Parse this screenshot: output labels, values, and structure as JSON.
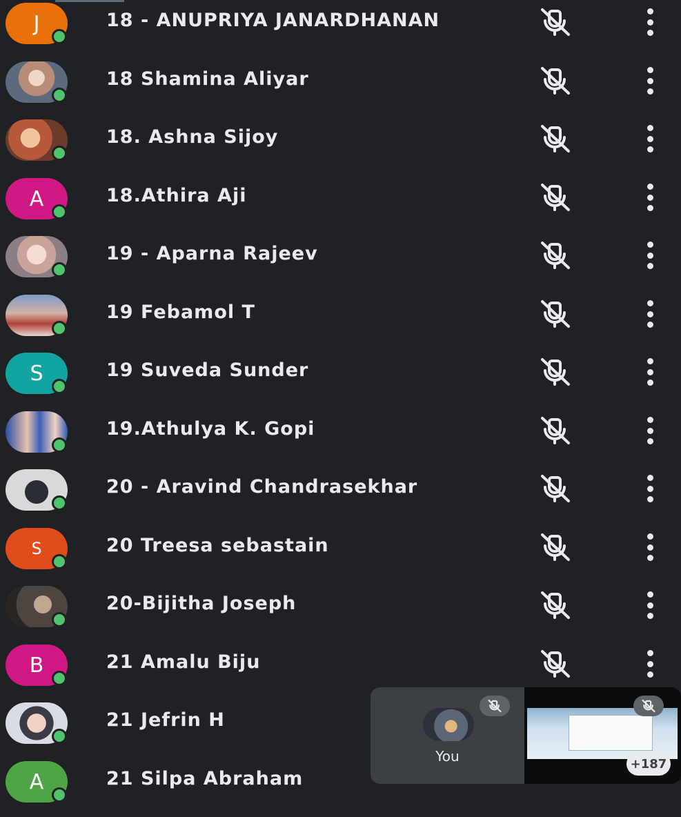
{
  "participants": [
    {
      "name": "18 - ANUPRIYA JANARDHANAN",
      "initial": "J",
      "color": "#e8710a"
    },
    {
      "name": "18 Shamina Aliyar",
      "initial": "",
      "color": ""
    },
    {
      "name": "18. Ashna Sijoy",
      "initial": "",
      "color": ""
    },
    {
      "name": "18.Athira Aji",
      "initial": "A",
      "color": "#d01884"
    },
    {
      "name": "19 - Aparna Rajeev",
      "initial": "",
      "color": ""
    },
    {
      "name": "19 Febamol T",
      "initial": "",
      "color": ""
    },
    {
      "name": "19 Suveda Sunder",
      "initial": "S",
      "color": "#12a4a0"
    },
    {
      "name": "19.Athulya K. Gopi",
      "initial": "",
      "color": ""
    },
    {
      "name": "20 - Aravind Chandrasekhar",
      "initial": "",
      "color": ""
    },
    {
      "name": "20 Treesa sebastain",
      "initial": "S",
      "color": "#e14c1c"
    },
    {
      "name": "20-Bijitha Joseph",
      "initial": "",
      "color": ""
    },
    {
      "name": "21 Amalu Biju",
      "initial": "B",
      "color": "#d01884"
    },
    {
      "name": "21 Jefrin H",
      "initial": "",
      "color": ""
    },
    {
      "name": "21 Silpa Abraham",
      "initial": "A",
      "color": "#4fa546"
    }
  ],
  "self_tile": {
    "label": "You"
  },
  "others_count": "+187",
  "icons": {
    "mic": "mic-off-icon",
    "more": "more-vert-icon"
  }
}
